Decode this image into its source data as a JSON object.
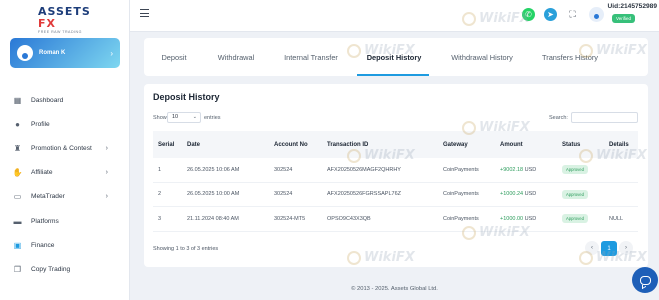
{
  "brand": {
    "name_main": "ASSETS",
    "name_accent": "FX",
    "tagline": "FREE RAW TRADING"
  },
  "user": {
    "name": "Roman K"
  },
  "nav": [
    {
      "label": "Dashboard",
      "icon": "grid-icon",
      "has_children": false
    },
    {
      "label": "Profile",
      "icon": "user-icon",
      "has_children": false
    },
    {
      "label": "Promotion & Contest",
      "icon": "trophy-icon",
      "has_children": true
    },
    {
      "label": "Affiliate",
      "icon": "handshake-icon",
      "has_children": true
    },
    {
      "label": "MetaTrader",
      "icon": "monitor-icon",
      "has_children": true
    },
    {
      "label": "Platforms",
      "icon": "display-icon",
      "has_children": false
    },
    {
      "label": "Finance",
      "icon": "wallet-icon",
      "has_children": false
    },
    {
      "label": "Copy Trading",
      "icon": "copy-icon",
      "has_children": false
    }
  ],
  "header": {
    "uid": "Uid:2145752989",
    "verified": "Verified"
  },
  "tabs": [
    {
      "label": "Deposit",
      "active": false
    },
    {
      "label": "Withdrawal",
      "active": false
    },
    {
      "label": "Internal Transfer",
      "active": false
    },
    {
      "label": "Deposit History",
      "active": true
    },
    {
      "label": "Withdrawal History",
      "active": false
    },
    {
      "label": "Transfers History",
      "active": false
    }
  ],
  "card": {
    "title": "Deposit History",
    "show_label": "Show",
    "entries_per_page": "10",
    "entries_label": "entries",
    "search_label": "Search:",
    "search_value": ""
  },
  "table": {
    "columns": [
      "Serial",
      "Date",
      "Account No",
      "Transaction ID",
      "Gateway",
      "Amount",
      "Status",
      "Details"
    ],
    "rows": [
      {
        "serial": "1",
        "date": "26.05.2025 10:06 AM",
        "account": "302524",
        "txid": "AFX20250526MAGF2QHRHY",
        "gateway": "CoinPayments",
        "amount": "+9002.18",
        "currency": "USD",
        "status": "Approved",
        "details": ""
      },
      {
        "serial": "2",
        "date": "26.05.2025 10:00 AM",
        "account": "302524",
        "txid": "AFX20250526FGRSSAPL76Z",
        "gateway": "CoinPayments",
        "amount": "+1000.24",
        "currency": "USD",
        "status": "Approved",
        "details": ""
      },
      {
        "serial": "3",
        "date": "21.11.2024 08:40 AM",
        "account": "302524-MT5",
        "txid": "OPSO9C43X3QB",
        "gateway": "CoinPayments",
        "amount": "+1000.00",
        "currency": "USD",
        "status": "Approved",
        "details": "NULL"
      }
    ]
  },
  "pagination": {
    "info": "Showing 1 to 3 of 3 entries",
    "prev": "‹",
    "current": "1",
    "next": "›"
  },
  "footer": {
    "copyright": "© 2013 - 2025. Assets Global Ltd."
  },
  "watermark": {
    "text": "WikiFX"
  },
  "colors": {
    "accent": "#1e9be0",
    "success": "#2c9c5c",
    "brand_red": "#e03a3a",
    "brand_blue": "#1d3d7a"
  }
}
